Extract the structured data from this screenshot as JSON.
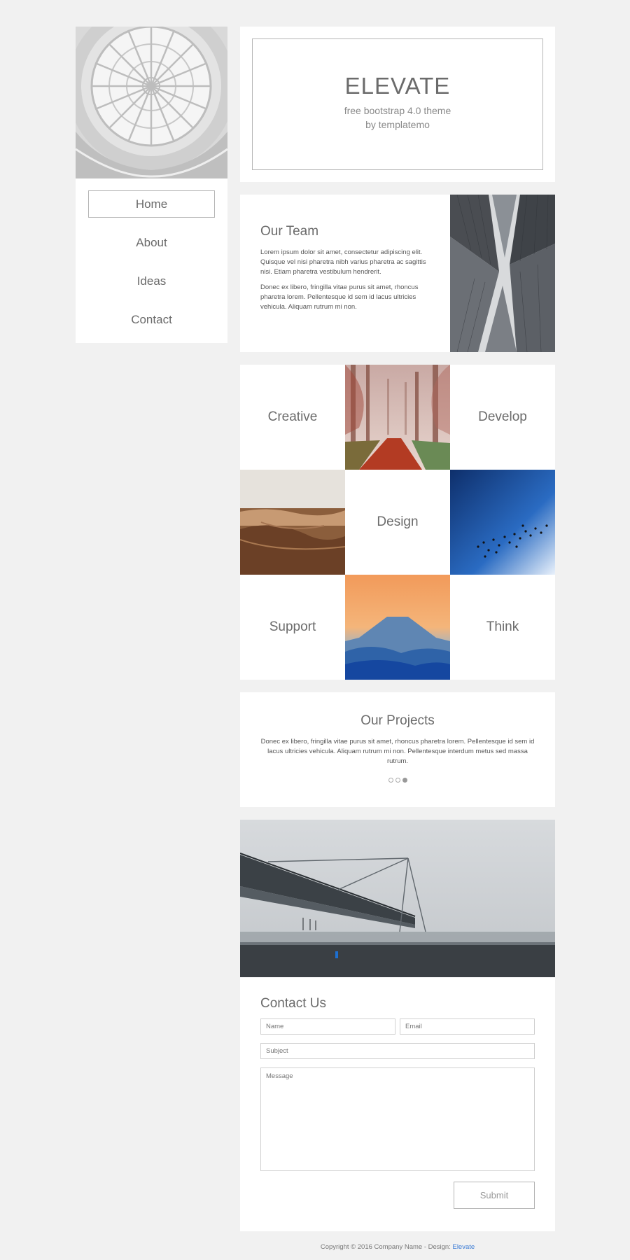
{
  "nav": {
    "items": [
      {
        "label": "Home",
        "active": true
      },
      {
        "label": "About",
        "active": false
      },
      {
        "label": "Ideas",
        "active": false
      },
      {
        "label": "Contact",
        "active": false
      }
    ]
  },
  "header": {
    "title": "ELEVATE",
    "subtitle": "free bootstrap 4.0 theme",
    "byline": "by templatemo"
  },
  "team": {
    "title": "Our Team",
    "p1": "Lorem ipsum dolor sit amet, consectetur adipiscing elit. Quisque vel nisi pharetra nibh varius pharetra ac sagittis nisi. Etiam pharetra vestibulum hendrerit.",
    "p2": "Donec ex libero, fringilla vitae purus sit amet, rhoncus pharetra lorem. Pellentesque id sem id lacus ultricies vehicula. Aliquam rutrum mi non."
  },
  "grid": {
    "creative": "Creative",
    "develop": "Develop",
    "design": "Design",
    "support": "Support",
    "think": "Think"
  },
  "projects": {
    "title": "Our Projects",
    "text": "Donec ex libero, fringilla vitae purus sit amet, rhoncus pharetra lorem. Pellentesque id sem id lacus ultricies vehicula. Aliquam rutrum mi non. Pellentesque interdum metus sed massa rutrum.",
    "active_slide": 3,
    "slide_count": 3
  },
  "contact": {
    "title": "Contact Us",
    "name_placeholder": "Name",
    "email_placeholder": "Email",
    "subject_placeholder": "Subject",
    "message_placeholder": "Message",
    "submit_label": "Submit"
  },
  "footer": {
    "copyright": "Copyright © 2016 Company Name - Design: ",
    "link": "Elevate"
  },
  "colors": {
    "background": "#f1f1f1",
    "card": "#ffffff",
    "text": "#6f6f6f",
    "link": "#3a7bd5"
  }
}
